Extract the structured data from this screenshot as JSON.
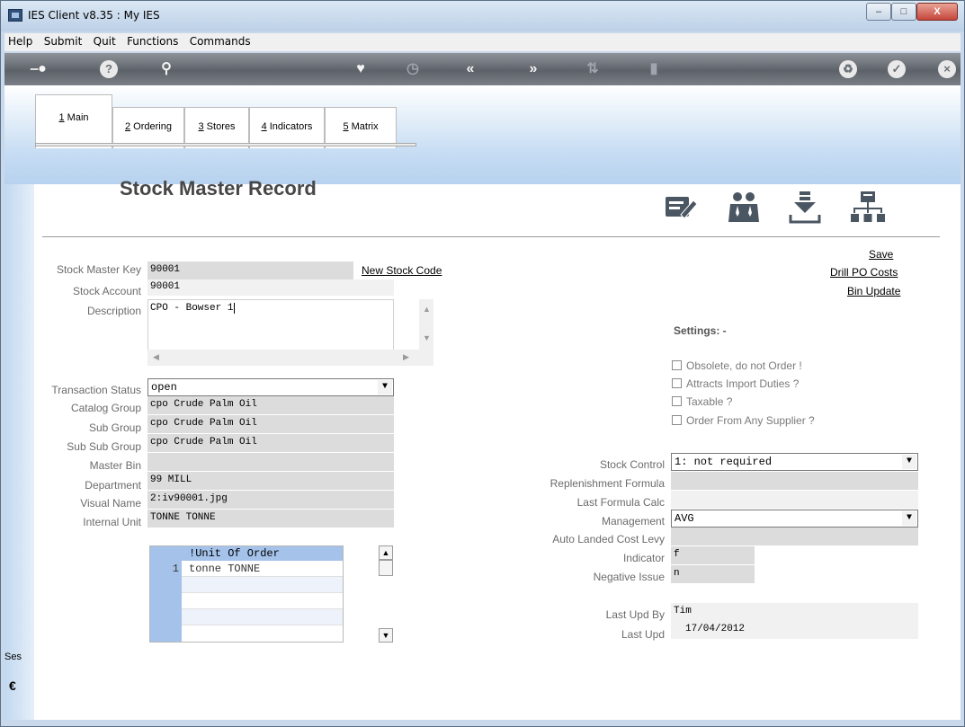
{
  "window": {
    "title": "IES Client v8.35 : My IES"
  },
  "menu": [
    "Help",
    "Submit",
    "Quit",
    "Functions",
    "Commands"
  ],
  "toolbar": {
    "icons": [
      "key-icon",
      "help-icon",
      "search-icon",
      "heart-icon",
      "clock-icon",
      "rewind-icon",
      "fast-forward-icon",
      "sort-icon",
      "record-icon",
      "recycle-icon",
      "check-icon",
      "close-icon"
    ]
  },
  "tabs": [
    {
      "key": "1",
      "label": " Main"
    },
    {
      "key": "2",
      "label": " Ordering"
    },
    {
      "key": "3",
      "label": " Stores"
    },
    {
      "key": "4",
      "label": " Indicators"
    },
    {
      "key": "5",
      "label": " Matrix"
    }
  ],
  "page": {
    "title": "Stock Master Record"
  },
  "links": {
    "new_stock_code": "New Stock Code",
    "save": "Save",
    "drill_po_costs": "Drill PO Costs",
    "bin_update": "Bin Update"
  },
  "form": {
    "stock_master_key": {
      "label": "Stock Master Key",
      "value": "90001"
    },
    "stock_account": {
      "label": "Stock Account",
      "value": "90001"
    },
    "description": {
      "label": "Description",
      "value": "CPO - Bowser 1"
    },
    "transaction_status": {
      "label": "Transaction Status",
      "value": "open"
    },
    "catalog_group": {
      "label": "Catalog Group",
      "value": "cpo Crude Palm Oil"
    },
    "sub_group": {
      "label": "Sub Group",
      "value": "cpo Crude Palm Oil"
    },
    "sub_sub_group": {
      "label": "Sub Sub Group",
      "value": "cpo Crude Palm Oil"
    },
    "master_bin": {
      "label": "Master Bin",
      "value": ""
    },
    "department": {
      "label": "Department",
      "value": "99 MILL"
    },
    "visual_name": {
      "label": "Visual Name",
      "value": "2:iv90001.jpg"
    },
    "internal_unit": {
      "label": "Internal Unit",
      "value": "TONNE TONNE"
    }
  },
  "unit_grid": {
    "header": "!Unit Of Order",
    "rows": [
      {
        "num": "1",
        "value": "tonne TONNE"
      }
    ]
  },
  "settings": {
    "title": "Settings: -",
    "checks": [
      "Obsolete, do not Order !",
      "Attracts Import Duties ?",
      "Taxable ?",
      "Order From Any Supplier ?"
    ]
  },
  "right_form": {
    "stock_control": {
      "label": "Stock Control",
      "value": "1: not required"
    },
    "replenishment_formula": {
      "label": "Replenishment Formula",
      "value": ""
    },
    "last_formula_calc": {
      "label": "Last Formula Calc",
      "value": ""
    },
    "management": {
      "label": "Management",
      "value": "AVG"
    },
    "auto_landed_cost_levy": {
      "label": "Auto Landed Cost Levy",
      "value": ""
    },
    "indicator": {
      "label": "Indicator",
      "value": "f"
    },
    "negative_issue": {
      "label": "Negative Issue",
      "value": "n"
    },
    "last_upd_by": {
      "label": "Last Upd By",
      "value": "Tim"
    },
    "last_upd": {
      "label": "Last Upd",
      "value": "17/04/2012"
    }
  },
  "session": {
    "label": "Ses"
  },
  "colors": {
    "toolbar": "#6b7078",
    "header_band": "#c5dcf3",
    "grid_header": "#a4c2ea"
  }
}
